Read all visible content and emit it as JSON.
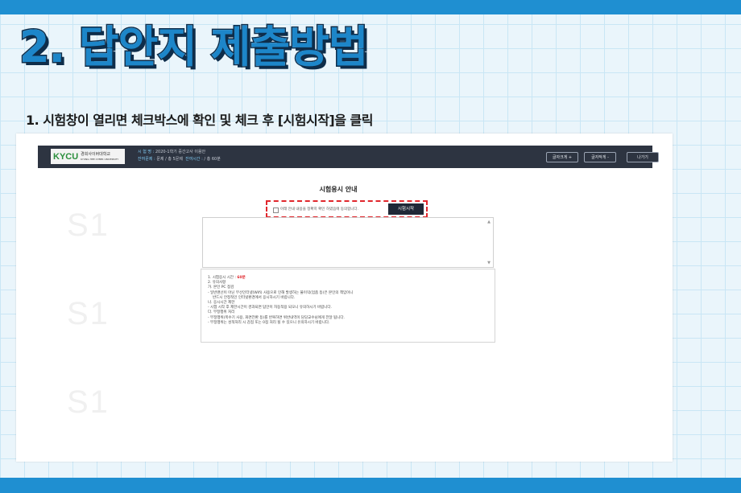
{
  "slide": {
    "title": "2. 답안지 제출방법",
    "subtitle": "1. 시험창이 열리면 체크박스에 확인 및 체크 후 [시험시작]을 클릭"
  },
  "app": {
    "logo_text": "KYCU",
    "logo_kor": "경희사이버대학교",
    "logo_eng": "KYUNG HEE CYBER UNIVERSITY",
    "exam_name_label": "시 험 명 :",
    "exam_name_value": "2020-1학기 중간고사 이용안",
    "remaining_label": "잔여문제 :",
    "remaining_value": "문제 / 총 5문제",
    "time_label": "잔여시간 :",
    "time_value": "/ 총 60분",
    "btn_font_up": "글자크게 +",
    "btn_font_down": "글자작게 -",
    "btn_exit": "나가기"
  },
  "guide": {
    "title": "시험응시 안내",
    "agree_text": "아래 안내 내용을 정확히 확인 하였음에 동의합니다.",
    "start_button": "시험시작"
  },
  "notice": {
    "l1_prefix": "1. 시험응시 시간 :",
    "l1_value": "60분",
    "l2": "2. 유의사항",
    "l3": "가. 본인 PC 점검",
    "l4": "- 일반랜선이 아닌 무선인터넷(Wifi) 사용으로 인해 발생하는 불이익(멈춤 등)은 본인의 책임이니",
    "l5": "반드시 안정적인 인터넷환경에서 응시하시기 바랍니다.",
    "l6": "나. 응시시간 제한",
    "l7": "- 시험 시작 후 제한시간이 경과되면 답안이 자동적용 되오니 유의하시기 바랍니다.",
    "l8": "다. 부정행위 처리",
    "l9": "- 부정행위(폭수기 사용, 화면전환 등)를 반복하면 위반내역이 담당교수님에게 전달 됩니다.",
    "l10": "- 부정행위는 성적처리 시 감점 또는 0점 처리 될 수 있으니 유의하시기 바랍니다."
  },
  "watermark": "S1"
}
